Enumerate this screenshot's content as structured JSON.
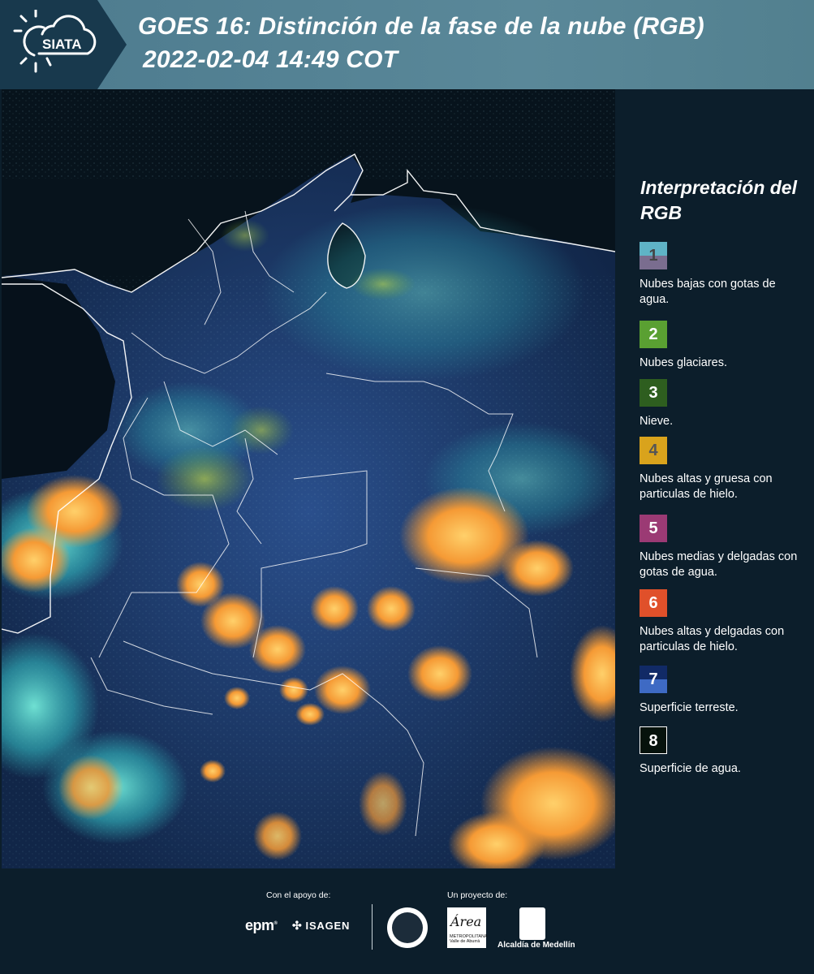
{
  "header": {
    "title_line1": "GOES 16: Distinción de la fase de la nube (RGB)",
    "title_line2": "2022-02-04 14:49 COT",
    "logo_text": "SIATA"
  },
  "legend": {
    "title": "Interpretación del RGB",
    "items": [
      {
        "num": "1",
        "label": "Nubes bajas con gotas de agua.",
        "color_top": "#5fb3c6",
        "color_bottom": "#7a6d8f"
      },
      {
        "num": "2",
        "label": "Nubes glaciares.",
        "color_top": "#5aa032",
        "color_bottom": "#5aa032"
      },
      {
        "num": "3",
        "label": "Nieve.",
        "color_top": "#2e5e1f",
        "color_bottom": "#2e5e1f"
      },
      {
        "num": "4",
        "label": "Nubes altas y gruesa con particulas de hielo.",
        "color_top": "#d9a31c",
        "color_bottom": "#d9a31c"
      },
      {
        "num": "5",
        "label": "Nubes medias y delgadas con gotas de agua.",
        "color_top": "#9b3a74",
        "color_bottom": "#9b3a74"
      },
      {
        "num": "6",
        "label": "Nubes altas y delgadas con particulas de hielo.",
        "color_top": "#e0502a",
        "color_bottom": "#e0502a"
      },
      {
        "num": "7",
        "label": "Superficie terreste.",
        "color_top": "#112a66",
        "color_bottom": "#3e6ac4"
      },
      {
        "num": "8",
        "label": "Superficie de agua.",
        "color_top": "#06120c",
        "color_bottom": "#06120c"
      }
    ]
  },
  "footer": {
    "support_label": "Con el apoyo de:",
    "project_label": "Un proyecto de:",
    "sponsor_epm": "epm",
    "sponsor_isagen": "ISAGEN",
    "amva_text": "Área",
    "amva_sub": "METROPOLITANA Valle de Aburrá",
    "medellin_label": "Alcaldía de Medellín"
  },
  "colors": {
    "background": "#0c1e2b",
    "header_band": "#5a8899",
    "ocean": "#07131c",
    "land": "#13305a",
    "cloud_orange": "#f4a23a",
    "cloud_cyan": "#3fc7c0"
  }
}
